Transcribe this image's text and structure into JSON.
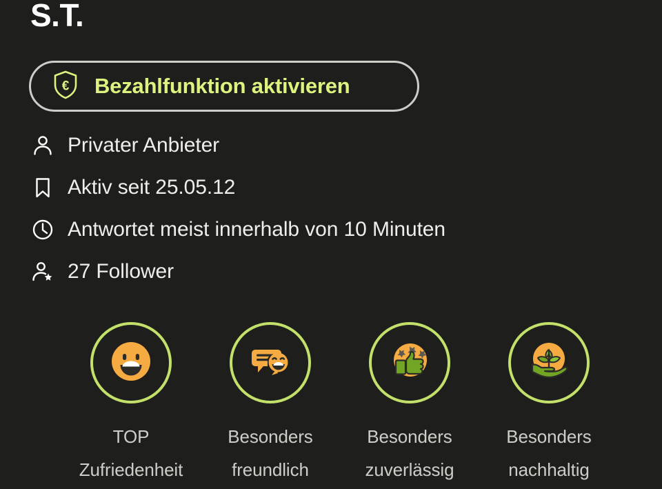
{
  "theme": {
    "background": "#1e1e1c",
    "accent_green": "#dcf37f",
    "ring_green": "#c2e06a",
    "badge_orange": "#f5ab42",
    "badge_leaf_green": "#73a524",
    "text_primary": "#f0eeea",
    "text_secondary": "#cfcdc7",
    "border_gray": "#cfcdc7"
  },
  "seller": {
    "name": "S.T."
  },
  "payment_cta": {
    "label": "Bezahlfunktion aktivieren",
    "icon": "shield-euro-icon"
  },
  "info": {
    "rows": [
      {
        "icon": "person-icon",
        "text": "Privater Anbieter"
      },
      {
        "icon": "bookmark-icon",
        "text": "Aktiv seit 25.05.12"
      },
      {
        "icon": "clock-icon",
        "text": "Antwortet meist innerhalb von 10 Minuten"
      },
      {
        "icon": "follower-icon",
        "text": "27 Follower"
      }
    ]
  },
  "badges": {
    "items": [
      {
        "icon": "smiley-face-icon",
        "label": "TOP\nZufriedenheit"
      },
      {
        "icon": "speech-bubbles-icon",
        "label": "Besonders\nfreundlich"
      },
      {
        "icon": "thumbs-up-stars-icon",
        "label": "Besonders\nzuverlässig"
      },
      {
        "icon": "hand-plant-icon",
        "label": "Besonders\nnachhaltig"
      }
    ]
  }
}
